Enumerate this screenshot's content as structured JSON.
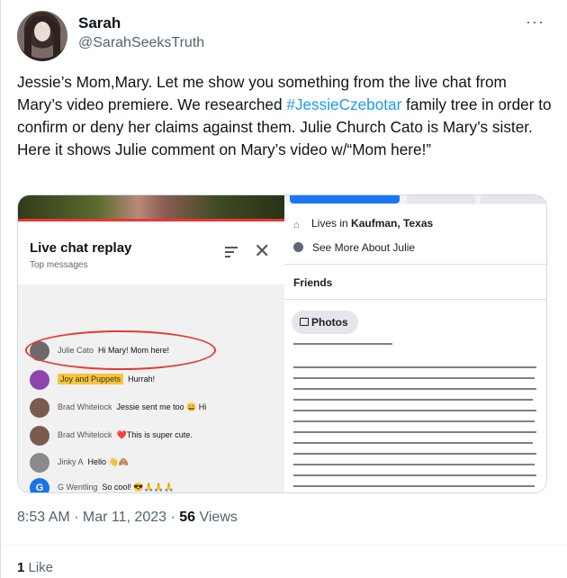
{
  "author": {
    "name": "Sarah",
    "handle": "@SarahSeeksTruth"
  },
  "tweet": {
    "text_before": "Jessie’s Mom,Mary. Let me show you something from the live chat from Mary’s video premiere. We researched ",
    "hashtag": "#JessieCzebotar",
    "text_after": " family tree in order to confirm or deny her claims against them. Julie Church Cato is Mary’s sister. Here it shows Julie comment on Mary’s video w/“Mom here!”"
  },
  "more_icon": "more-dots-icon",
  "media": {
    "chat": {
      "title": "Live chat replay",
      "subtitle": "Top messages",
      "messages": [
        {
          "author": "Julie Cato",
          "text": "Hi Mary! Mom here!",
          "avatar_color": "#6b6b6b"
        },
        {
          "author": "Joy and Puppets",
          "text": "Hurrah!",
          "avatar_color": "#8e44ad",
          "member": true
        },
        {
          "author": "Brad Whitelock",
          "text": "Jessie sent me too 😀 Hi",
          "avatar_color": "#7a5c4f"
        },
        {
          "author": "Brad Whitelock",
          "text": "❤️This is super cute.",
          "avatar_color": "#7a5c4f"
        },
        {
          "author": "Jinky A",
          "text": "Hello 👋🙈",
          "avatar_color": "#8a8a8a"
        },
        {
          "author": "G Wentling",
          "text": "So cool! 😎🙏🙏🙏",
          "avatar_color": "#1a73e8",
          "initial": "G"
        }
      ]
    },
    "profile": {
      "lives_in_label": "Lives in ",
      "lives_in_place": "Kaufman, Texas",
      "see_more": "See More About Julie",
      "friends": "Friends",
      "photos": "Photos"
    }
  },
  "meta": {
    "time": "8:53 AM · Mar 11, 2023 · ",
    "views_count": "56",
    "views_label": " Views"
  },
  "likes": {
    "count": "1",
    "label": " Like"
  }
}
